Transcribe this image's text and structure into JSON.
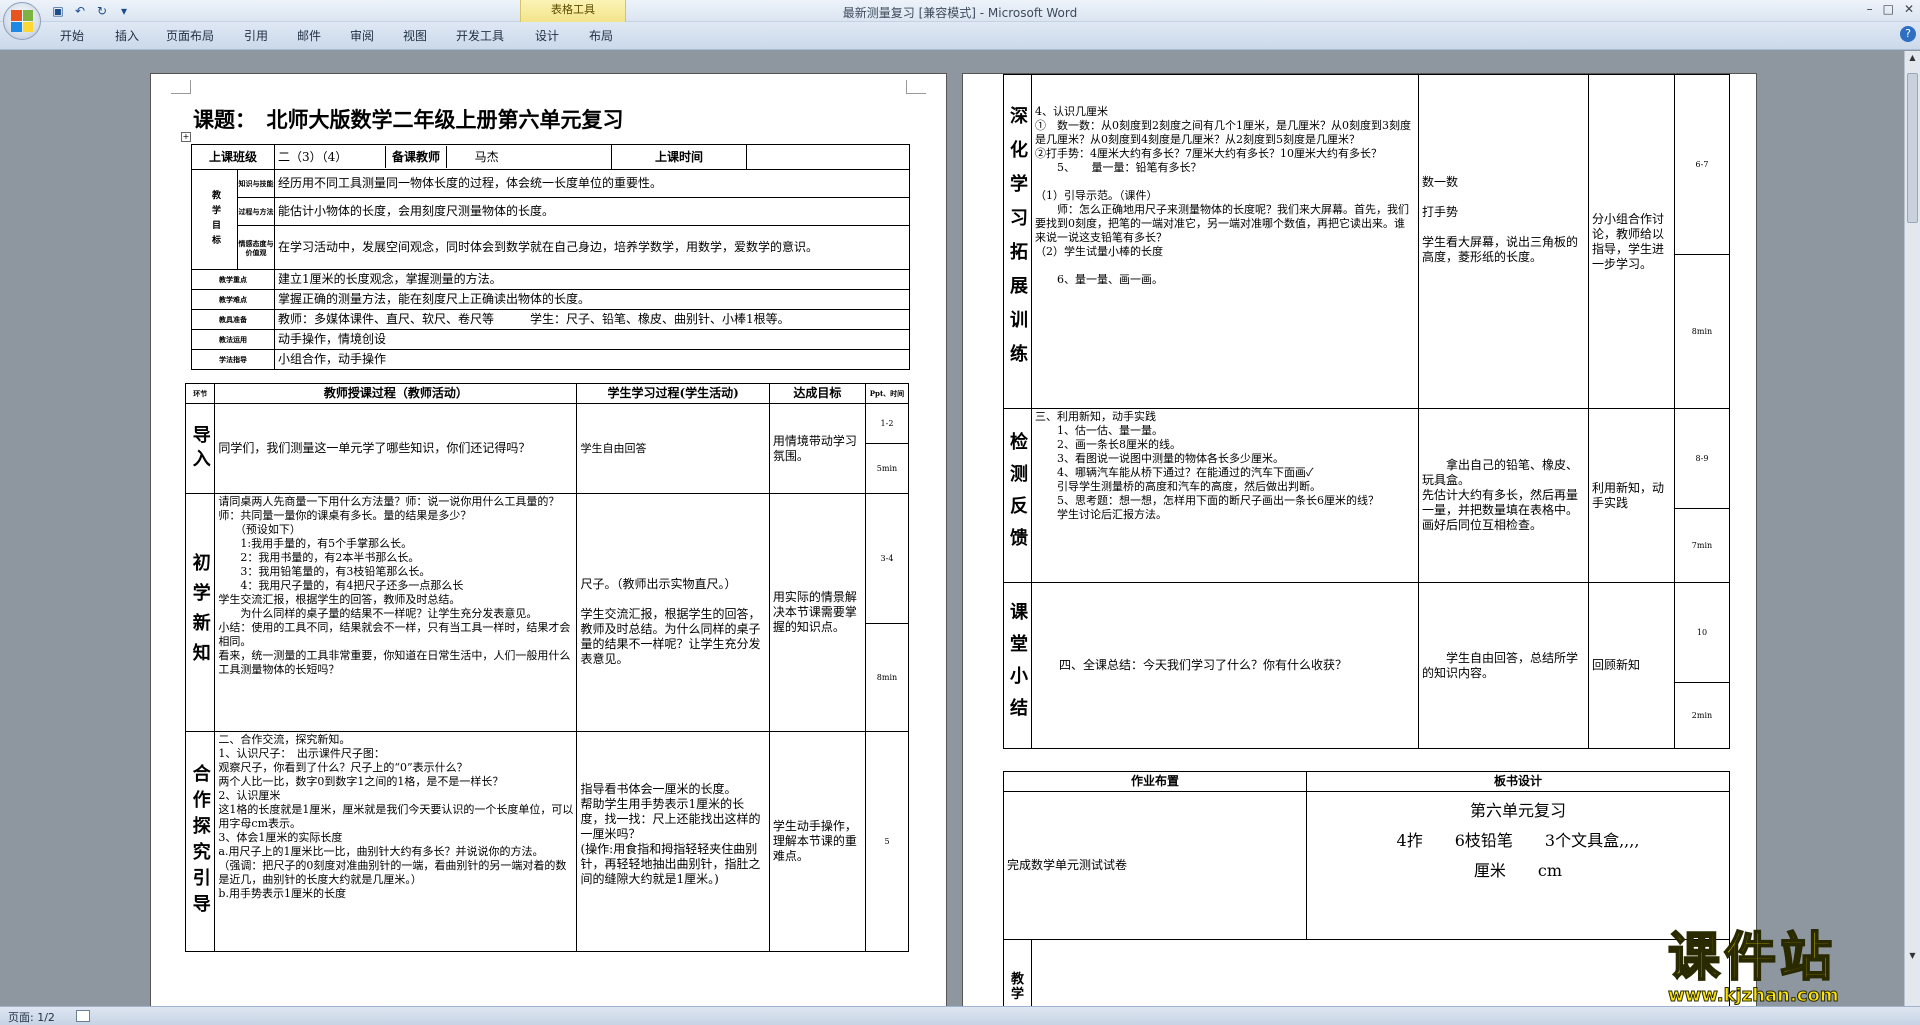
{
  "window": {
    "title": "最新测量复习 [兼容模式] - Microsoft Word",
    "context_tab_group": "表格工具"
  },
  "ribbon": {
    "tabs": [
      "开始",
      "插入",
      "页面布局",
      "引用",
      "邮件",
      "审阅",
      "视图",
      "开发工具",
      "设计",
      "布局"
    ]
  },
  "status": {
    "page": "页面: 1/2"
  },
  "doc": {
    "title": "课题：　北师大版数学二年级上册第六单元复习",
    "info": {
      "class_label": "上课班级",
      "class_value": "二（3）（4）",
      "teacher_label": "备课教师",
      "teacher_value": "马杰",
      "time_label": "上课时间"
    },
    "goals_label": "教学目标",
    "goals": [
      {
        "tag": "知识与技能",
        "text": "经历用不同工具测量同一物体长度的过程，体会统一长度单位的重要性。"
      },
      {
        "tag": "过程与方法",
        "text": "能估计小物体的长度，会用刻度尺测量物体的长度。"
      },
      {
        "tag": "情感态度与价值观",
        "text": "在学习活动中，发展空间观念，同时体会到数学就在自己身边，培养学数学，用数学，爱数学的意识。"
      }
    ],
    "rows": [
      {
        "tag": "教学重点",
        "text": "建立1厘米的长度观念，掌握测量的方法。"
      },
      {
        "tag": "教学难点",
        "text": "掌握正确的测量方法，能在刻度尺上正确读出物体的长度。"
      },
      {
        "tag": "教具准备",
        "text": "教师：多媒体课件、直尺、软尺、卷尺等　　　学生：尺子、铅笔、橡皮、曲别针、小棒1根等。"
      },
      {
        "tag": "教法运用",
        "text": "动手操作，情境创设"
      },
      {
        "tag": "学法指导",
        "text": "小组合作，动手操作"
      }
    ],
    "process_header": {
      "phase": "环节",
      "teacher": "教师授课过程（教师活动）",
      "student": "学生学习过程(学生活动)",
      "goal": "达成目标",
      "time": "Ppt、时间"
    },
    "phases": [
      {
        "name": "导入",
        "teacher": "同学们，我们测量这一单元学了哪些知识，你们还记得吗？",
        "student": "学生自由回答",
        "goal": "用情境带动学习氛围。",
        "time1": "1-2",
        "time2": "5min"
      },
      {
        "name": "初学新知",
        "teacher": "请同桌两人先商量一下用什么方法量？师：说一说你用什么工具量的？　师：共同量一量你的课桌有多长。量的结果是多少？\n　　（预设如下）\n　　1:我用手量的，有5个手掌那么长。\n　　2：我用书量的，有2本半书那么长。\n　　3：我用铅笔量的，有3枝铅笔那么长。\n　　4：我用尺子量的，有4把尺子还多一点那么长\n学生交流汇报，根据学生的回答，教师及时总结。\n　　为什么同样的桌子量的结果不一样呢？让学生充分发表意见。\n小结：使用的工具不同，结果就会不一样，只有当工具一样时，结果才会相同。\n看来，统一测量的工具非常重要，你知道在日常生活中，人们一般用什么工具测量物体的长短吗？",
        "student": "尺子。（教师出示实物直尺。）\n\n学生交流汇报，根据学生的回答，教师及时总结。为什么同样的桌子量的结果不一样呢？让学生充分发表意见。",
        "goal": "用实际的情景解决本节课需要掌握的知识点。",
        "time1": "3-4",
        "time2": "8min"
      },
      {
        "name": "合作探究引导",
        "teacher": "二、合作交流，探究新知。\n1、认识尺子：　出示课件尺子图：\n观察尺子，你看到了什么？尺子上的“0”表示什么？\n两个人比一比，数字0到数字1之间的1格，是不是一样长？\n2、认识厘米\n这1格的长度就是1厘米，厘米就是我们今天要认识的一个长度单位，可以用字母cm表示。\n3、体会1厘米的实际长度\na.用尺子上的1厘米比一比，曲别针大约有多长？并说说你的方法。\n（强调：把尺子的0刻度对准曲别针的一端，看曲别针的另一端对着的数是近几，曲别针的长度大约就是几厘米。）\nb.用手势表示1厘米的长度",
        "student": "指导看书体会一厘米的长度。\n帮助学生用手势表示1厘米的长度，找一找：尺上还能找出这样的一厘米吗？\n(操作:用食指和拇指轻轻夹住曲别针，再轻轻地抽出曲别针，指肚之间的缝隙大约就是1厘米。)",
        "goal": "学生动手操作，理解本节课的重难点。",
        "time1": "5"
      }
    ],
    "right": {
      "deepen": {
        "name": "深化学习拓展训练",
        "teacher": "4、认识几厘米\n①　数一数：从0刻度到2刻度之间有几个1厘米，是几厘米？从0刻度到3刻度是几厘米？从0刻度到4刻度是几厘米？从2刻度到5刻度是几厘米？\n②打手势：4厘米大约有多长？7厘米大约有多长？10厘米大约有多长？\n　　5、　　量一量：铅笔有多长？\n\n（1）引导示范。（课件）\n　　师：怎么正确地用尺子来测量物体的长度呢？我们来大屏幕。首先，我们要找到0刻度，把笔的一端对准它，另一端对准哪个数值，再把它读出来。谁来说一说这支铅笔有多长？\n（2）学生试量小棒的长度\n\n　　6、量一量、画一画。",
        "student": "数一数\n\n打手势\n\n学生看大屏幕，说出三角板的高度，菱形纸的长度。",
        "goal": "分小组合作讨论，教师给以指导，学生进一步学习。",
        "time1": "6-7",
        "time2": "8min"
      },
      "check": {
        "name": "检测反馈",
        "teacher": "三、利用新知，动手实践\n　　1、估一估、量一量。\n　　2、画一条长8厘米的线。\n　　3、看图说一说图中测量的物体各长多少厘米。\n　　4、哪辆汽车能从桥下通过？在能通过的汽车下面画✓\n　　引导学生测量桥的高度和汽车的高度，然后做出判断。\n　　5、思考题：想一想，怎样用下面的断尺子画出一条长6厘米的线？\n　　学生讨论后汇报方法。",
        "student": "　　拿出自己的铅笔、橡皮、玩具盒。\n先估计大约有多长，然后再量一量，并把数量填在表格中。\n画好后同位互相检查。",
        "goal": "利用新知，动手实践",
        "time1": "8-9",
        "time2": "7min"
      },
      "summary": {
        "name": "课堂小结",
        "teacher": "　　四、全课总结：今天我们学习了什么？你有什么收获？",
        "student": "　　学生自由回答，总结所学的知识内容。",
        "goal": "回顾新知",
        "time1": "10",
        "time2": "2min"
      },
      "homework_label": "作业布置",
      "board_label": "板书设计",
      "homework": "完成数学单元测试试卷",
      "board_title": "第六单元复习",
      "board_line1": "4拃　　6枝铅笔　　3个文具盒,,,,",
      "board_line2": "厘米　　cm",
      "reflection_label": "教学"
    }
  },
  "watermark": {
    "name": "课件站",
    "url": "www.kjzhan.com"
  },
  "colors": {
    "workspace": "#8e969f",
    "ribbon": "#dbe5f1",
    "context_tab": "#f3e48a",
    "watermark": "#ffe600"
  }
}
